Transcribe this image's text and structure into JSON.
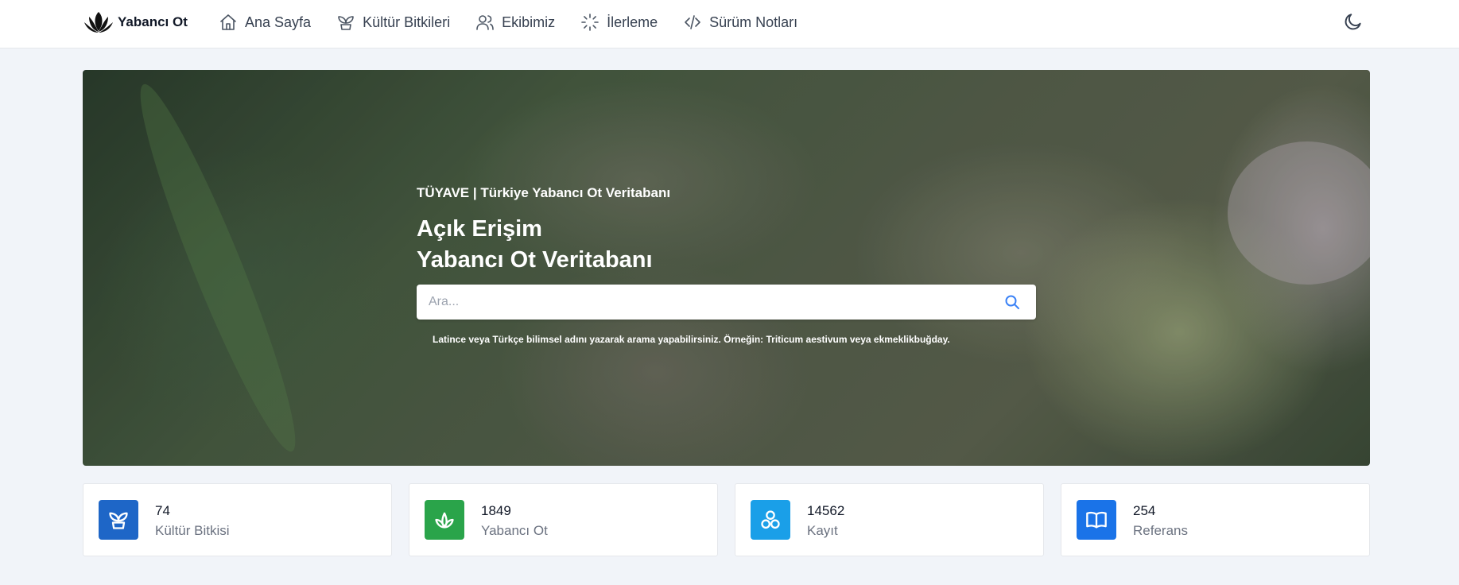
{
  "navbar": {
    "brand": "Yabancı Ot",
    "brand_icon": "lotus-logo",
    "items": [
      {
        "label": "Ana Sayfa",
        "icon": "home-icon"
      },
      {
        "label": "Kültür Bitkileri",
        "icon": "sprout-icon"
      },
      {
        "label": "Ekibimiz",
        "icon": "users-icon"
      },
      {
        "label": "İlerleme",
        "icon": "loader-icon"
      },
      {
        "label": "Sürüm Notları",
        "icon": "code-icon"
      }
    ],
    "theme_icon": "moon-icon"
  },
  "hero": {
    "subtitle": "TÜYAVE | Türkiye Yabancı Ot Veritabanı",
    "title_line1": "Açık Erişim",
    "title_line2": "Yabancı Ot Veritabanı",
    "search_placeholder": "Ara...",
    "search_value": "",
    "hint": "Latince veya Türkçe bilimsel adını yazarak arama yapabilirsiniz. Örneğin: Triticum aestivum veya ekmeklikbuğday."
  },
  "stats": [
    {
      "value": "74",
      "label": "Kültür Bitkisi",
      "icon": "sprout-icon",
      "color": "#1e66c7"
    },
    {
      "value": "1849",
      "label": "Yabancı Ot",
      "icon": "leaf-icon",
      "color": "#2aa44a"
    },
    {
      "value": "14562",
      "label": "Kayıt",
      "icon": "circles-icon",
      "color": "#1a9fe8"
    },
    {
      "value": "254",
      "label": "Referans",
      "icon": "book-open-icon",
      "color": "#1a73e8"
    }
  ]
}
